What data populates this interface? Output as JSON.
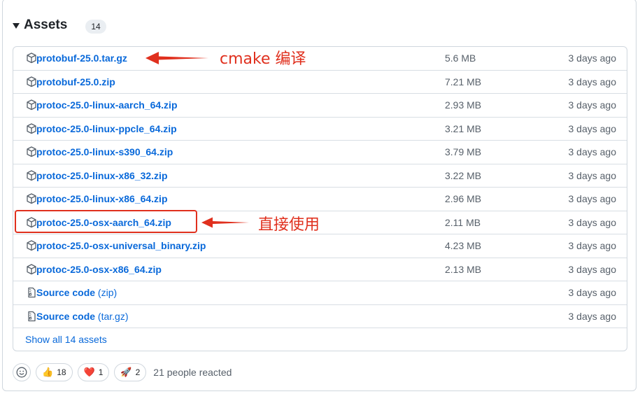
{
  "assets": {
    "title": "Assets",
    "count": "14",
    "show_all": "Show all 14 assets",
    "files": [
      {
        "name": "protobuf-25.0.tar.gz",
        "size": "5.6 MB",
        "date": "3 days ago"
      },
      {
        "name": "protobuf-25.0.zip",
        "size": "7.21 MB",
        "date": "3 days ago"
      },
      {
        "name": "protoc-25.0-linux-aarch_64.zip",
        "size": "2.93 MB",
        "date": "3 days ago"
      },
      {
        "name": "protoc-25.0-linux-ppcle_64.zip",
        "size": "3.21 MB",
        "date": "3 days ago"
      },
      {
        "name": "protoc-25.0-linux-s390_64.zip",
        "size": "3.79 MB",
        "date": "3 days ago"
      },
      {
        "name": "protoc-25.0-linux-x86_32.zip",
        "size": "3.22 MB",
        "date": "3 days ago"
      },
      {
        "name": "protoc-25.0-linux-x86_64.zip",
        "size": "2.96 MB",
        "date": "3 days ago"
      },
      {
        "name": "protoc-25.0-osx-aarch_64.zip",
        "size": "2.11 MB",
        "date": "3 days ago"
      },
      {
        "name": "protoc-25.0-osx-universal_binary.zip",
        "size": "4.23 MB",
        "date": "3 days ago"
      },
      {
        "name": "protoc-25.0-osx-x86_64.zip",
        "size": "2.13 MB",
        "date": "3 days ago"
      }
    ],
    "source": [
      {
        "name": "Source code",
        "suffix": "(zip)",
        "date": "3 days ago"
      },
      {
        "name": "Source code",
        "suffix": "(tar.gz)",
        "date": "3 days ago"
      }
    ]
  },
  "annotations": {
    "cmake": "cmake 编译",
    "direct": "直接使用"
  },
  "reactions": {
    "items": [
      {
        "emoji": "👍",
        "count": "18"
      },
      {
        "emoji": "❤️",
        "count": "1"
      },
      {
        "emoji": "🚀",
        "count": "2"
      }
    ],
    "summary": "21 people reacted"
  },
  "colors": {
    "link": "#0969da",
    "annotation": "#e0301e",
    "muted": "#57606a",
    "border": "#d0d7de"
  }
}
